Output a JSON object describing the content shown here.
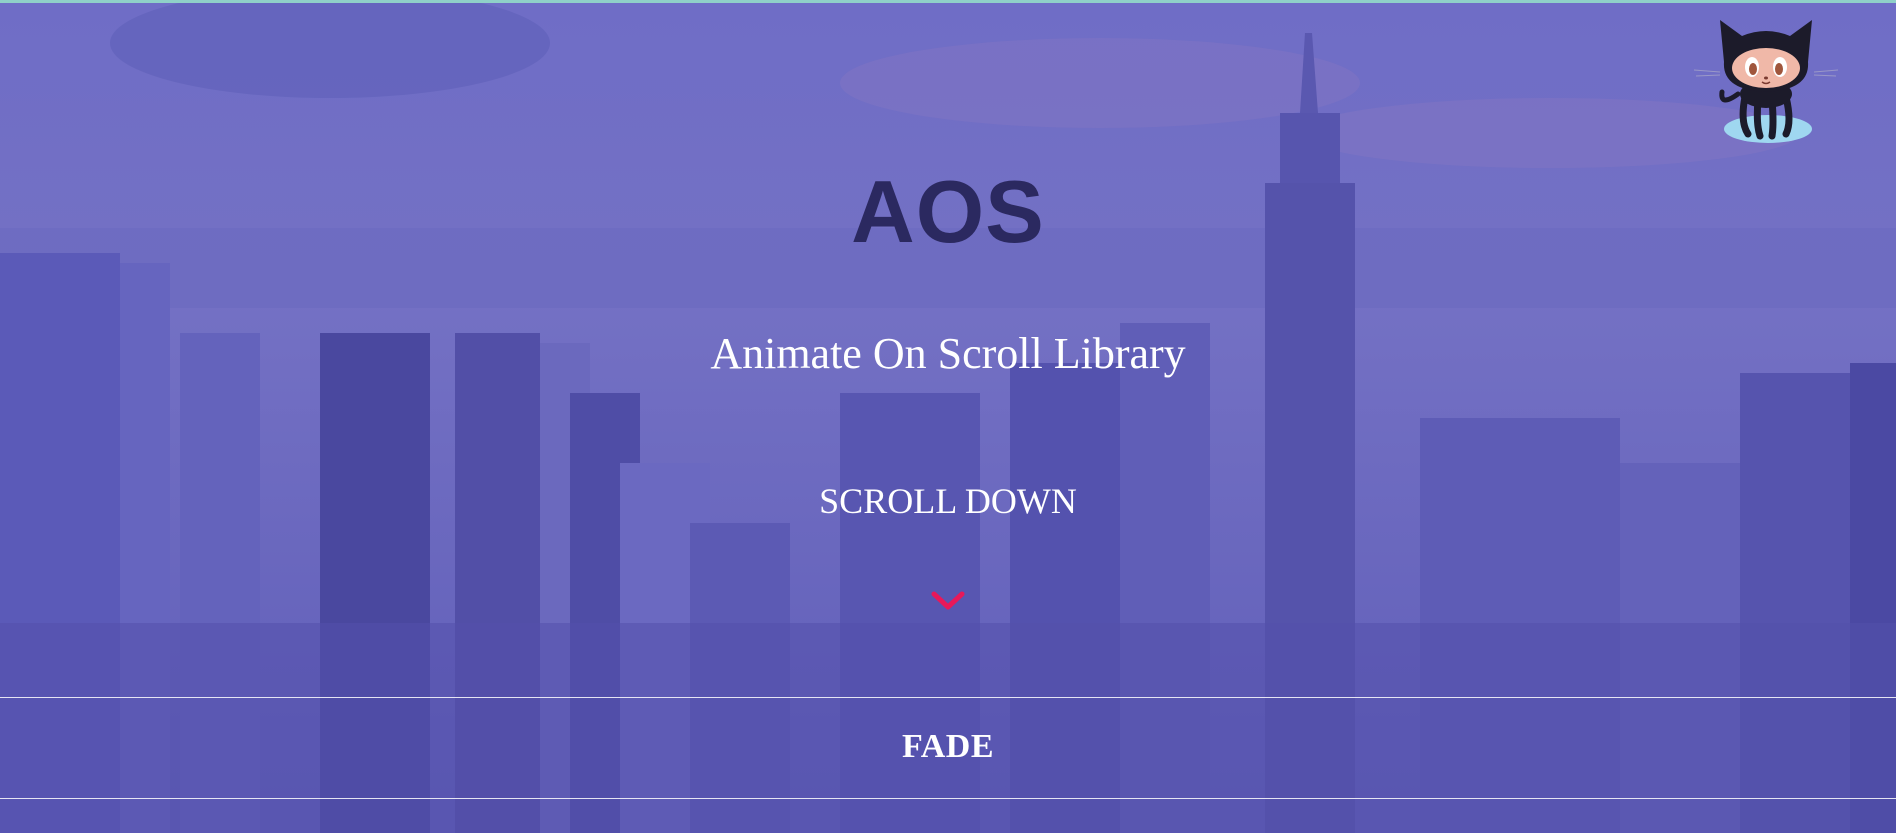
{
  "hero": {
    "title": "AOS",
    "subtitle": "Animate On Scroll Library",
    "scroll_hint": "SCROLL DOWN"
  },
  "icons": {
    "scroll_arrow": "chevron-down-icon",
    "github_corner": "octocat-icon"
  },
  "sections": [
    {
      "label": "FADE"
    }
  ],
  "colors": {
    "overlay": "#6a68c2",
    "title": "#2b2960",
    "text": "#ffffff",
    "accent": "#e8185a"
  }
}
